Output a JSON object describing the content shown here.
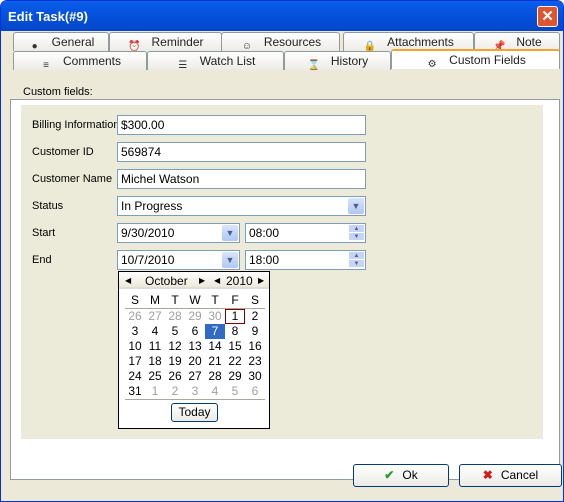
{
  "window": {
    "title": "Edit Task(#9)"
  },
  "tabs_row1": [
    {
      "label": "General",
      "icon": "globe-icon"
    },
    {
      "label": "Reminder",
      "icon": "alarm-clock-icon"
    },
    {
      "label": "Resources",
      "icon": "user-icon"
    },
    {
      "label": "Attachments",
      "icon": "lock-icon"
    },
    {
      "label": "Note",
      "icon": "pin-icon"
    }
  ],
  "tabs_row2": [
    {
      "label": "Comments",
      "icon": "comments-icon"
    },
    {
      "label": "Watch List",
      "icon": "watch-list-icon"
    },
    {
      "label": "History",
      "icon": "history-icon"
    },
    {
      "label": "Custom Fields",
      "icon": "gear-icon",
      "active": true
    }
  ],
  "custom_fields_label": "Custom fields:",
  "fields": {
    "billing_label": "Billing Information",
    "billing": "$300.00",
    "customer_id_label": "Customer ID",
    "customer_id": "569874",
    "customer_name_label": "Customer Name",
    "customer_name": "Michel Watson",
    "status_label": "Status",
    "status": "In Progress",
    "start_label": "Start",
    "start_date": "9/30/2010",
    "start_time": "08:00",
    "end_label": "End",
    "end_date": "10/7/2010",
    "end_time": "18:00"
  },
  "calendar": {
    "month": "October",
    "year": "2010",
    "weekdays": [
      "S",
      "M",
      "T",
      "W",
      "T",
      "F",
      "S"
    ],
    "weeks": [
      [
        "26",
        "27",
        "28",
        "29",
        "30",
        "1",
        "2"
      ],
      [
        "3",
        "4",
        "5",
        "6",
        "7",
        "8",
        "9"
      ],
      [
        "10",
        "11",
        "12",
        "13",
        "14",
        "15",
        "16"
      ],
      [
        "17",
        "18",
        "19",
        "20",
        "21",
        "22",
        "23"
      ],
      [
        "24",
        "25",
        "26",
        "27",
        "28",
        "29",
        "30"
      ],
      [
        "31",
        "1",
        "2",
        "3",
        "4",
        "5",
        "6"
      ]
    ],
    "selected": "7",
    "today": "1",
    "today_label": "Today"
  },
  "buttons": {
    "ok": "Ok",
    "cancel": "Cancel"
  },
  "colors": {
    "title_bar": "#0553e0",
    "selection": "#316ac5",
    "today_border": "#800000"
  }
}
